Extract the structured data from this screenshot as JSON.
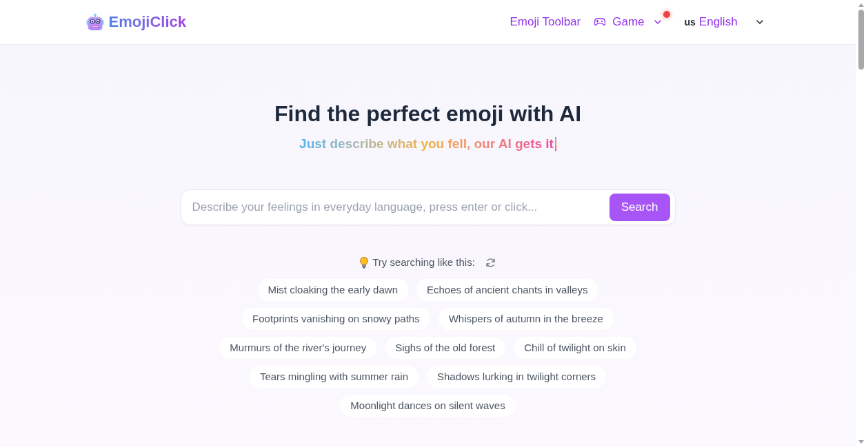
{
  "header": {
    "logo": "EmojiClick",
    "nav": [
      {
        "label": "Emoji Toolbar",
        "kind": "link",
        "notification": false
      },
      {
        "label": "Game",
        "kind": "menu",
        "notification": true
      }
    ],
    "language": {
      "flag": "us",
      "label": "English"
    }
  },
  "hero": {
    "title": "Find the perfect emoji with AI",
    "subtitle": "Just describe what you fell, our AI gets it"
  },
  "search": {
    "placeholder": "Describe your feelings in everyday language, press enter or click...",
    "button": "Search"
  },
  "suggestions": {
    "label": "Try searching like this:",
    "items": [
      "Mist cloaking the early dawn",
      "Echoes of ancient chants in valleys",
      "Footprints vanishing on snowy paths",
      "Whispers of autumn in the breeze",
      "Murmurs of the river's journey",
      "Sighs of the old forest",
      "Chill of twilight on skin",
      "Tears mingling with summer rain",
      "Shadows lurking in twilight corners",
      "Moonlight dances on silent waves"
    ]
  }
}
